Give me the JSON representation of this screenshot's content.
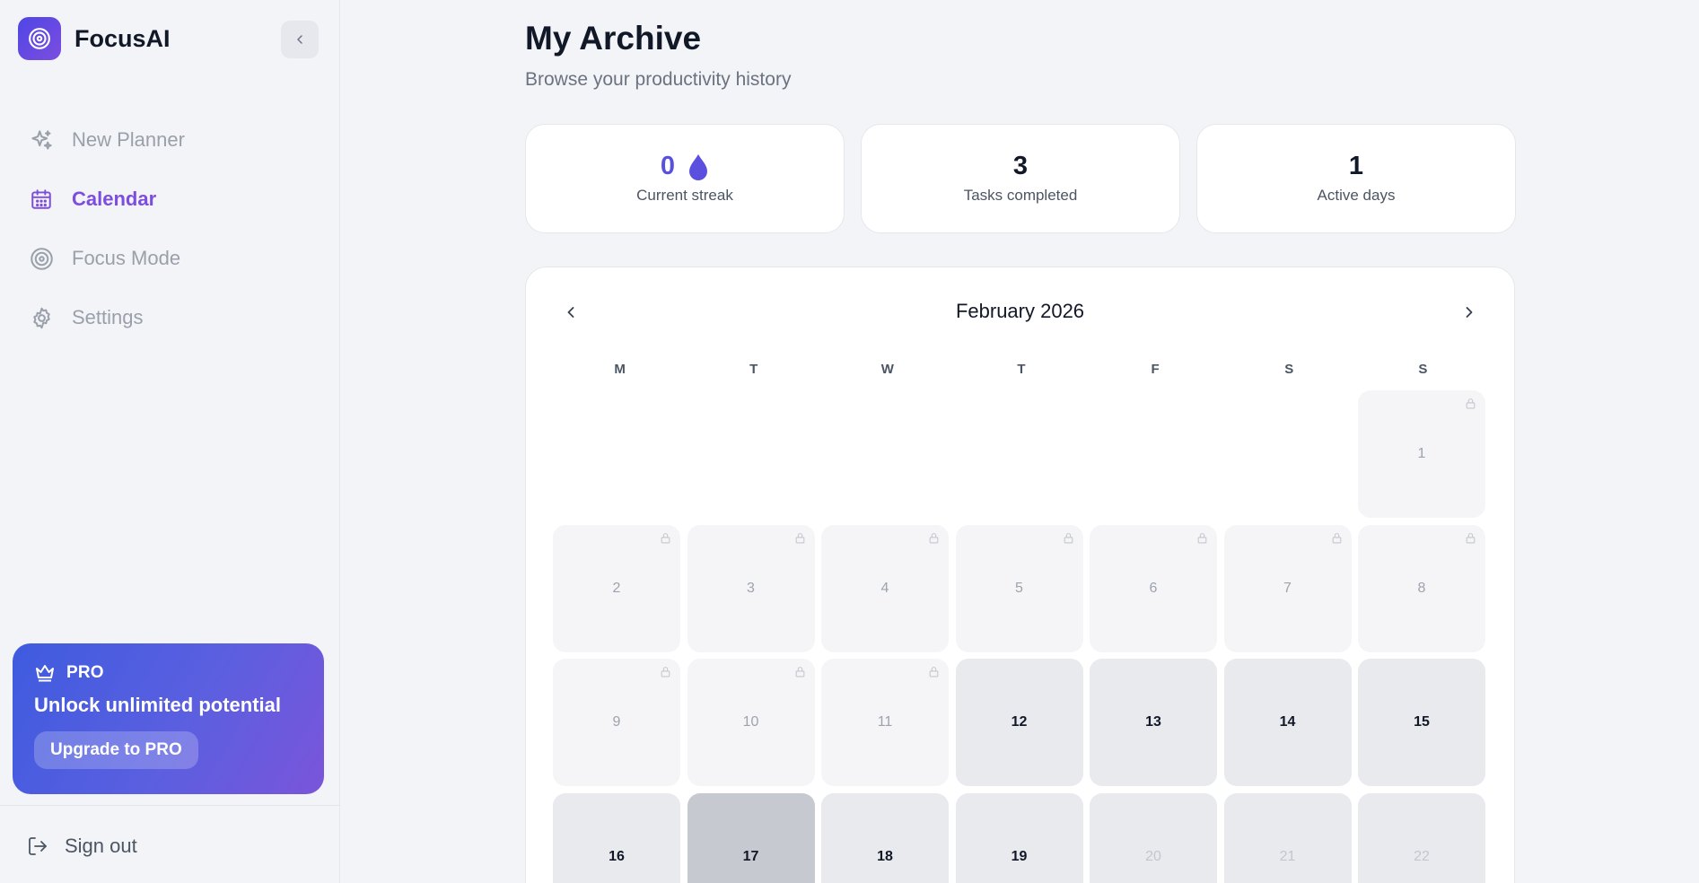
{
  "app": {
    "name": "FocusAI",
    "accent": "#7c4ddf",
    "brand_gradient": [
      "#4f46e5",
      "#7c4ddf"
    ]
  },
  "sidebar": {
    "items": [
      {
        "label": "New Planner",
        "icon": "sparkle-icon",
        "active": false
      },
      {
        "label": "Calendar",
        "icon": "calendar-icon",
        "active": true
      },
      {
        "label": "Focus Mode",
        "icon": "target-icon",
        "active": false
      },
      {
        "label": "Settings",
        "icon": "gear-icon",
        "active": false
      }
    ],
    "pro": {
      "badge": "PRO",
      "text": "Unlock unlimited potential",
      "button": "Upgrade to PRO"
    },
    "signout": "Sign out"
  },
  "main": {
    "title": "My Archive",
    "subtitle": "Browse your productivity history",
    "stats": [
      {
        "value": "0",
        "label": "Current streak",
        "icon": "flame-icon"
      },
      {
        "value": "3",
        "label": "Tasks completed"
      },
      {
        "value": "1",
        "label": "Active days"
      }
    ],
    "calendar": {
      "month": "February 2026",
      "weekdays": [
        "M",
        "T",
        "W",
        "T",
        "F",
        "S",
        "S"
      ],
      "leading_empty": 6,
      "days": [
        {
          "n": "1",
          "state": "locked"
        },
        {
          "n": "2",
          "state": "locked"
        },
        {
          "n": "3",
          "state": "locked"
        },
        {
          "n": "4",
          "state": "locked"
        },
        {
          "n": "5",
          "state": "locked"
        },
        {
          "n": "6",
          "state": "locked"
        },
        {
          "n": "7",
          "state": "locked"
        },
        {
          "n": "8",
          "state": "locked"
        },
        {
          "n": "9",
          "state": "locked"
        },
        {
          "n": "10",
          "state": "locked"
        },
        {
          "n": "11",
          "state": "locked"
        },
        {
          "n": "12",
          "state": "active"
        },
        {
          "n": "13",
          "state": "active"
        },
        {
          "n": "14",
          "state": "active"
        },
        {
          "n": "15",
          "state": "active"
        },
        {
          "n": "16",
          "state": "active"
        },
        {
          "n": "17",
          "state": "today"
        },
        {
          "n": "18",
          "state": "active"
        },
        {
          "n": "19",
          "state": "active"
        },
        {
          "n": "20",
          "state": "future"
        },
        {
          "n": "21",
          "state": "future"
        },
        {
          "n": "22",
          "state": "future"
        }
      ]
    }
  }
}
